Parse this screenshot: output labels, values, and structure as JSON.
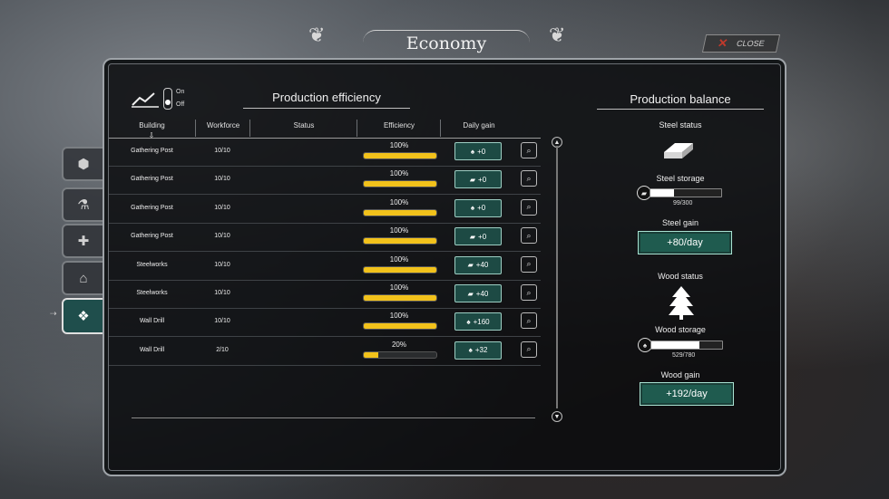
{
  "window": {
    "title": "Economy",
    "close_label": "CLOSE"
  },
  "colors": {
    "accent_teal": "#1f5b4f",
    "efficiency_bar": "#f2c21b",
    "close_x": "#c0392b"
  },
  "sidebar": {
    "tabs": [
      {
        "icon": "cube-icon",
        "glyph": "⬢"
      },
      {
        "icon": "flask-icon",
        "glyph": "⚗"
      },
      {
        "icon": "medical-cross-icon",
        "glyph": "✚"
      },
      {
        "icon": "house-icon",
        "glyph": "⌂"
      },
      {
        "icon": "economy-diamonds-icon",
        "glyph": "❖",
        "active": true
      }
    ]
  },
  "toggle": {
    "on_label": "On",
    "off_label": "Off"
  },
  "production": {
    "title": "Production efficiency",
    "columns": [
      "Building",
      "Workforce",
      "Status",
      "Efficiency",
      "Daily gain"
    ],
    "rows": [
      {
        "building": "Gathering Post",
        "workforce": "10/10",
        "efficiency_label": "100%",
        "efficiency": 100,
        "resource": "wood",
        "gain": "+0"
      },
      {
        "building": "Gathering Post",
        "workforce": "10/10",
        "efficiency_label": "100%",
        "efficiency": 100,
        "resource": "steel",
        "gain": "+0"
      },
      {
        "building": "Gathering Post",
        "workforce": "10/10",
        "efficiency_label": "100%",
        "efficiency": 100,
        "resource": "wood",
        "gain": "+0"
      },
      {
        "building": "Gathering Post",
        "workforce": "10/10",
        "efficiency_label": "100%",
        "efficiency": 100,
        "resource": "steel",
        "gain": "+0"
      },
      {
        "building": "Steelworks",
        "workforce": "10/10",
        "efficiency_label": "100%",
        "efficiency": 100,
        "resource": "steel",
        "gain": "+40"
      },
      {
        "building": "Steelworks",
        "workforce": "10/10",
        "efficiency_label": "100%",
        "efficiency": 100,
        "resource": "steel",
        "gain": "+40"
      },
      {
        "building": "Wall Drill",
        "workforce": "10/10",
        "efficiency_label": "100%",
        "efficiency": 100,
        "resource": "wood",
        "gain": "+160"
      },
      {
        "building": "Wall Drill",
        "workforce": "2/10",
        "efficiency_label": "20%",
        "efficiency": 20,
        "resource": "wood",
        "gain": "+32"
      }
    ]
  },
  "balance": {
    "title": "Production balance",
    "steel": {
      "status_label": "Steel status",
      "storage_label": "Steel storage",
      "storage_value": "99/300",
      "fill": 0.33,
      "gain_label": "Steel gain",
      "gain_value": "+80/day"
    },
    "wood": {
      "status_label": "Wood status",
      "storage_label": "Wood storage",
      "storage_value": "529/780",
      "fill": 0.68,
      "gain_label": "Wood gain",
      "gain_value": "+192/day"
    }
  }
}
